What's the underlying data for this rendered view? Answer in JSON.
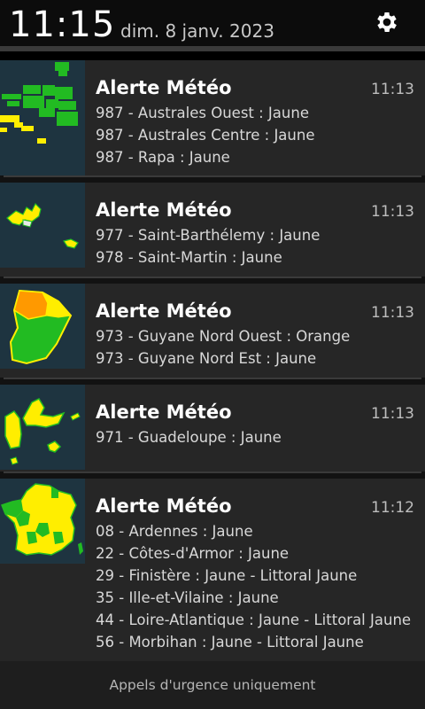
{
  "status_bar": {
    "time": "11:15",
    "date": "dim. 8 janv. 2023",
    "settings_icon": "gear-icon"
  },
  "notifications": [
    {
      "title": "Alerte Météo",
      "time": "11:13",
      "thumbnail": "map-australes",
      "lines": [
        "987 - Australes Ouest : Jaune",
        "987 - Australes Centre : Jaune",
        "987 - Rapa : Jaune"
      ]
    },
    {
      "title": "Alerte Météo",
      "time": "11:13",
      "thumbnail": "map-saint-barthelemy-saint-martin",
      "lines": [
        "977 - Saint-Barthélemy : Jaune",
        "978 - Saint-Martin : Jaune"
      ]
    },
    {
      "title": "Alerte Météo",
      "time": "11:13",
      "thumbnail": "map-guyane",
      "lines": [
        "973 - Guyane Nord Ouest : Orange",
        "973 - Guyane Nord Est : Jaune"
      ]
    },
    {
      "title": "Alerte Météo",
      "time": "11:13",
      "thumbnail": "map-guadeloupe",
      "lines": [
        "971 - Guadeloupe : Jaune"
      ]
    },
    {
      "title": "Alerte Météo",
      "time": "11:12",
      "thumbnail": "map-france",
      "lines": [
        "08 - Ardennes : Jaune",
        "22 - Côtes-d'Armor : Jaune",
        "29 - Finistère : Jaune - Littoral Jaune",
        "35 - Ille-et-Vilaine : Jaune",
        "44 - Loire-Atlantique : Jaune - Littoral Jaune",
        "56 - Morbihan : Jaune - Littoral Jaune"
      ]
    }
  ],
  "footer": {
    "emergency_label": "Appels d'urgence uniquement"
  },
  "colors": {
    "alert_yellow": "#ffee00",
    "alert_orange": "#ff9900",
    "alert_green": "#22bb22",
    "map_sea": "#1e3440"
  }
}
